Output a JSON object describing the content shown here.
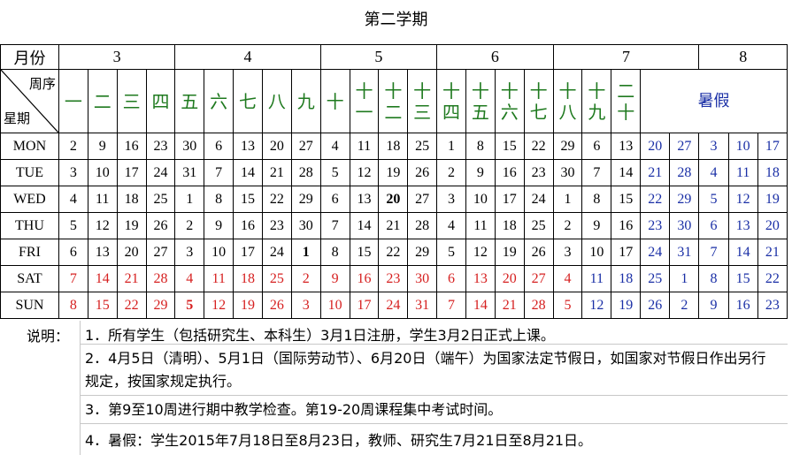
{
  "title": "第二学期",
  "headers": {
    "month": "月份",
    "week_top": "周序",
    "week_bottom": "星期"
  },
  "months": [
    {
      "label": "3",
      "span": 4
    },
    {
      "label": "4",
      "span": 5
    },
    {
      "label": "5",
      "span": 4
    },
    {
      "label": "6",
      "span": 4
    },
    {
      "label": "7",
      "span": 5
    },
    {
      "label": "8",
      "span": 3
    }
  ],
  "weeks": [
    "一",
    "二",
    "三",
    "四",
    "五",
    "六",
    "七",
    "八",
    "九",
    "十",
    "十一",
    "十二",
    "十三",
    "十四",
    "十五",
    "十六",
    "十七",
    "十八",
    "十九",
    "二十"
  ],
  "summer_label": "暑假",
  "days": [
    {
      "label": "MON",
      "values": [
        "2",
        "9",
        "16",
        "23",
        "30",
        "6",
        "13",
        "20",
        "27",
        "4",
        "11",
        "18",
        "25",
        "1",
        "8",
        "15",
        "22",
        "29",
        "6",
        "13",
        "20",
        "27",
        "3",
        "10",
        "17"
      ]
    },
    {
      "label": "TUE",
      "values": [
        "3",
        "10",
        "17",
        "24",
        "31",
        "7",
        "14",
        "21",
        "28",
        "5",
        "12",
        "19",
        "26",
        "2",
        "9",
        "16",
        "23",
        "30",
        "7",
        "14",
        "21",
        "28",
        "4",
        "11",
        "18"
      ]
    },
    {
      "label": "WED",
      "values": [
        "4",
        "11",
        "18",
        "25",
        "1",
        "8",
        "15",
        "22",
        "29",
        "6",
        "13",
        "20",
        "27",
        "3",
        "10",
        "17",
        "24",
        "1",
        "8",
        "15",
        "22",
        "29",
        "5",
        "12",
        "19"
      ]
    },
    {
      "label": "THU",
      "values": [
        "5",
        "12",
        "19",
        "26",
        "2",
        "9",
        "16",
        "23",
        "30",
        "7",
        "14",
        "21",
        "28",
        "4",
        "11",
        "18",
        "25",
        "2",
        "9",
        "16",
        "23",
        "30",
        "6",
        "13",
        "20"
      ]
    },
    {
      "label": "FRI",
      "values": [
        "6",
        "13",
        "20",
        "27",
        "3",
        "10",
        "17",
        "24",
        "1",
        "8",
        "15",
        "22",
        "29",
        "5",
        "12",
        "19",
        "26",
        "3",
        "10",
        "17",
        "24",
        "31",
        "7",
        "14",
        "21"
      ]
    },
    {
      "label": "SAT",
      "values": [
        "7",
        "14",
        "21",
        "28",
        "4",
        "11",
        "18",
        "25",
        "2",
        "9",
        "16",
        "23",
        "30",
        "6",
        "13",
        "20",
        "27",
        "4",
        "11",
        "18",
        "25",
        "1",
        "8",
        "15",
        "22"
      ]
    },
    {
      "label": "SUN",
      "values": [
        "8",
        "15",
        "22",
        "29",
        "5",
        "12",
        "19",
        "26",
        "3",
        "10",
        "17",
        "24",
        "31",
        "7",
        "14",
        "21",
        "28",
        "5",
        "12",
        "19",
        "26",
        "2",
        "9",
        "16",
        "23"
      ]
    }
  ],
  "colors": {
    "weekday": "#000000",
    "weekend": "#d62020",
    "summer": "#1a2fa6",
    "week_label": "#1f7a1f"
  },
  "bold_cells": [
    "WED-11",
    "FRI-8",
    "SUN-4"
  ],
  "notes": {
    "label": "说明：",
    "items": [
      "1．所有学生（包括研究生、本科生）3月1日注册，学生3月2日正式上课。",
      "2．4月5日（清明）、5月1日（国际劳动节）、6月20日（端午）为国家法定节假日，如国家对节假日作出另行规定，按国家规定执行。",
      "3．第9至10周进行期中教学检查。第19-20周课程集中考试时间。",
      "4．暑假：学生2015年7月18日至8月23日，教师、研究生7月21日至8月21日。"
    ]
  }
}
